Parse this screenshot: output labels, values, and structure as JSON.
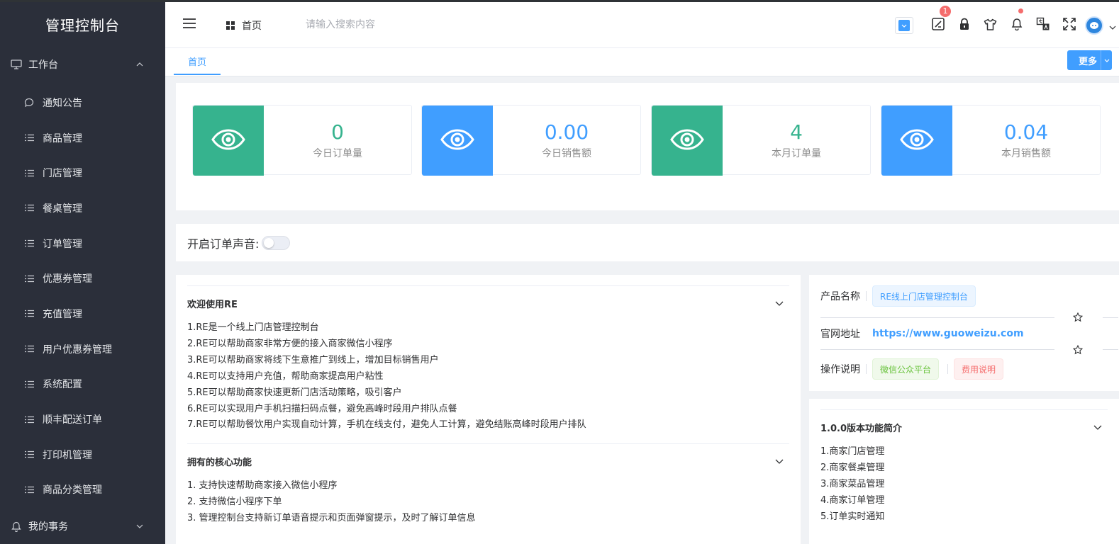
{
  "app": {
    "title": "管理控制台"
  },
  "sidebar": {
    "group_workbench": "工作台",
    "items": [
      {
        "label": "通知公告",
        "icon": "chat-bubble-icon"
      },
      {
        "label": "商品管理",
        "icon": "list-icon"
      },
      {
        "label": "门店管理",
        "icon": "list-icon"
      },
      {
        "label": "餐桌管理",
        "icon": "list-icon"
      },
      {
        "label": "订单管理",
        "icon": "list-icon"
      },
      {
        "label": "优惠券管理",
        "icon": "list-icon"
      },
      {
        "label": "充值管理",
        "icon": "list-icon"
      },
      {
        "label": "用户优惠券管理",
        "icon": "list-icon"
      },
      {
        "label": "系统配置",
        "icon": "list-icon"
      },
      {
        "label": "顺丰配送订单",
        "icon": "list-icon"
      },
      {
        "label": "打印机管理",
        "icon": "list-icon"
      },
      {
        "label": "商品分类管理",
        "icon": "list-icon"
      }
    ],
    "group_affairs": "我的事务"
  },
  "header": {
    "breadcrumb": "首页",
    "search_placeholder": "请输入搜索内容",
    "badge_count": "1"
  },
  "tabs": {
    "active": "首页",
    "more_label": "更多"
  },
  "stats": [
    {
      "value": "0",
      "label": "今日订单量",
      "color": "#36b38e"
    },
    {
      "value": "0.00",
      "label": "今日销售额",
      "color": "#409eff"
    },
    {
      "value": "4",
      "label": "本月订单量",
      "color": "#36b38e"
    },
    {
      "value": "0.04",
      "label": "本月销售额",
      "color": "#409eff"
    }
  ],
  "sound": {
    "label": "开启订单声音:",
    "enabled": false
  },
  "intro": {
    "welcome_title": "欢迎使用RE",
    "welcome_lines": [
      "1.RE是一个线上门店管理控制台",
      "2.RE可以帮助商家非常方便的接入商家微信小程序",
      "3.RE可以帮助商家将线下生意推广到线上，增加目标销售用户",
      "4.RE可以支持用户充值，帮助商家提高用户粘性",
      "5.RE可以帮助商家快速更新门店活动策略，吸引客户",
      "6.RE可以实现用户手机扫描扫码点餐，避免高峰时段用户排队点餐",
      "7.RE可以帮助餐饮用户实现自动计算，手机在线支付，避免人工计算，避免结账高峰时段用户排队"
    ],
    "core_title": "拥有的核心功能",
    "core_lines": [
      "1. 支持快速帮助商家接入微信小程序",
      "2. 支持微信小程序下单",
      "3. 管理控制台支持新订单语音提示和页面弹窗提示，及时了解订单信息"
    ]
  },
  "info": {
    "product_key": "产品名称",
    "product_value": "RE线上门店管理控制台",
    "site_key": "官网地址",
    "site_value": "https://www.guoweizu.com",
    "ops_key": "操作说明",
    "ops_tag1": "微信公众平台",
    "ops_tag2": "费用说明"
  },
  "version": {
    "title": "1.0.0版本功能简介",
    "lines": [
      "1.商家门店管理",
      "2.商家餐桌管理",
      "3.商家菜品管理",
      "4.商家订单管理",
      "5.订单实时通知"
    ]
  }
}
